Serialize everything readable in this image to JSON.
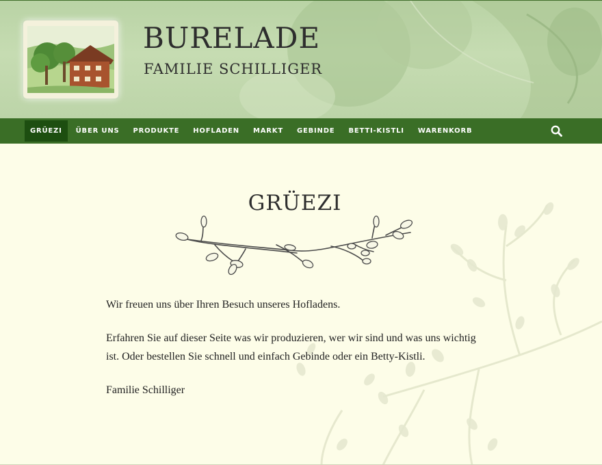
{
  "site": {
    "title": "BURELADE",
    "subtitle": "FAMILIE SCHILLIGER"
  },
  "nav": {
    "items": [
      {
        "label": "GRÜEZI",
        "active": true
      },
      {
        "label": "ÜBER UNS",
        "active": false
      },
      {
        "label": "PRODUKTE",
        "active": false
      },
      {
        "label": "HOFLADEN",
        "active": false
      },
      {
        "label": "MARKT",
        "active": false
      },
      {
        "label": "GEBINDE",
        "active": false
      },
      {
        "label": "BETTI-KISTLI",
        "active": false
      },
      {
        "label": "WARENKORB",
        "active": false
      }
    ],
    "search_icon": "search-icon"
  },
  "main": {
    "title": "GRÜEZI",
    "paragraphs": [
      "Wir freuen uns über Ihren Besuch unseres Hofladens.",
      "Erfahren Sie auf dieser Seite was wir produzieren, wer wir sind und was uns wichtig ist. Oder bestellen Sie schnell und einfach Gebinde oder ein Betty-Kistli.",
      "Familie Schilliger"
    ]
  },
  "colors": {
    "nav_bg": "#3a6e26",
    "nav_active": "#1d4e10",
    "page_bg": "#fdfde8",
    "header_bg": "#c2d9ad"
  }
}
